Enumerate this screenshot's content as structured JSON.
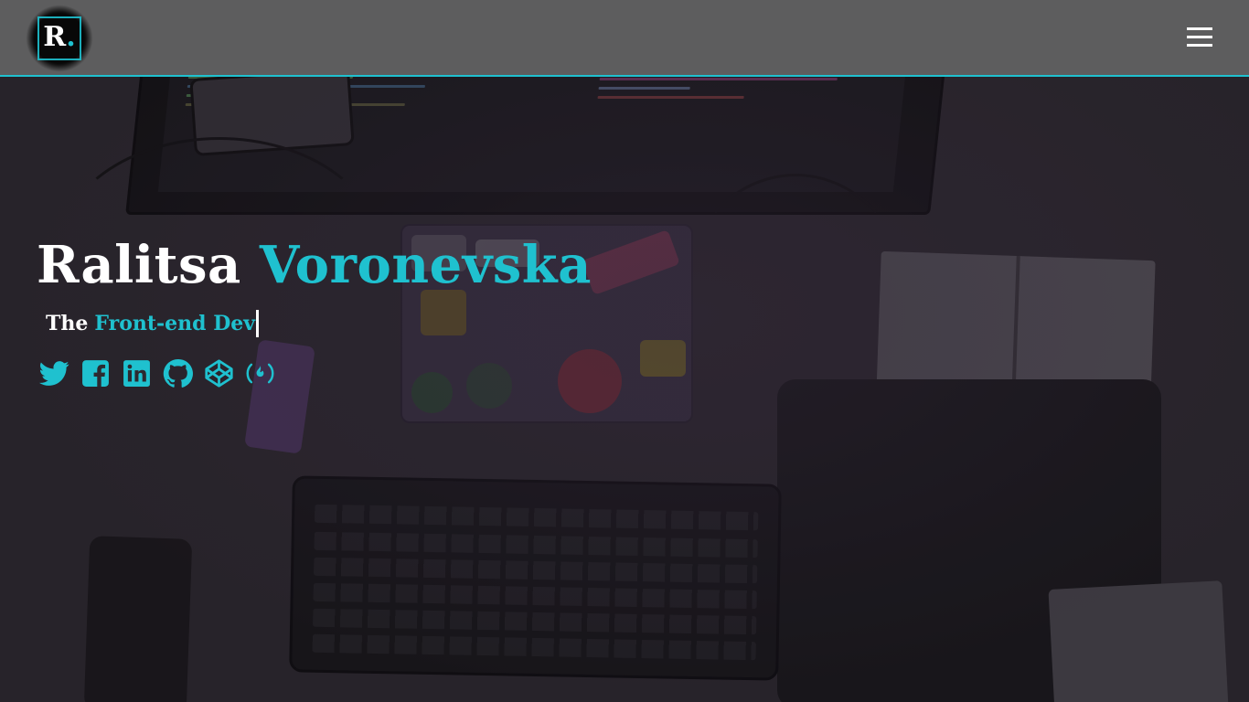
{
  "header": {
    "logo_letter": "R",
    "logo_dot": ".",
    "menu_icon": "hamburger-menu-icon"
  },
  "hero": {
    "first_name": "Ralitsa",
    "last_name": "Voronevska",
    "tagline_prefix": "The",
    "tagline_role": "Front-end Dev"
  },
  "social_links": [
    {
      "name": "Twitter",
      "icon": "twitter-icon"
    },
    {
      "name": "Facebook",
      "icon": "facebook-icon"
    },
    {
      "name": "LinkedIn",
      "icon": "linkedin-icon"
    },
    {
      "name": "GitHub",
      "icon": "github-icon"
    },
    {
      "name": "CodePen",
      "icon": "codepen-icon"
    },
    {
      "name": "freeCodeCamp",
      "icon": "freecodecamp-icon"
    }
  ],
  "colors": {
    "accent": "#1fc1cf",
    "header_bg": "#5d5d5e",
    "text": "#ffffff"
  }
}
